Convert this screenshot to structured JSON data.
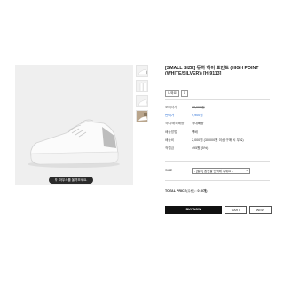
{
  "product": {
    "title": "[SMALL SIZE] 듀하 하이 포인트 (HIGH POINT (WHITE/SILVER)) [H-9113]",
    "zoom_label": "마우스를 올려보세요."
  },
  "badges": [
    "나와요",
    "1"
  ],
  "info": [
    {
      "label": "소비자가",
      "value": "49,000원",
      "style": "strike"
    },
    {
      "label": "판매가",
      "value": "9,900원",
      "style": "blue"
    },
    {
      "label": "국내/해외배송",
      "value": "국내배송",
      "style": ""
    },
    {
      "label": "배송방법",
      "value": "택배",
      "style": ""
    },
    {
      "label": "배송비",
      "value": "2,000원 (30,000원 이상 구매 시 무료)",
      "style": ""
    },
    {
      "label": "적립금",
      "value": "495원 (5%)",
      "style": ""
    }
  ],
  "options": {
    "size_label": "SIZE",
    "size_selected": "- [필수] 옵션을 선택해 주세요 -"
  },
  "total": {
    "label": "TOTAL PRICE",
    "qty": "(수량)",
    "value": "0 (0개)"
  },
  "buttons": {
    "buy": "BUY NOW",
    "cart": "CART",
    "wish": "WISH"
  },
  "icons": {
    "zoom": "magnifier-icon",
    "dropdown": "chevron-down-icon"
  }
}
